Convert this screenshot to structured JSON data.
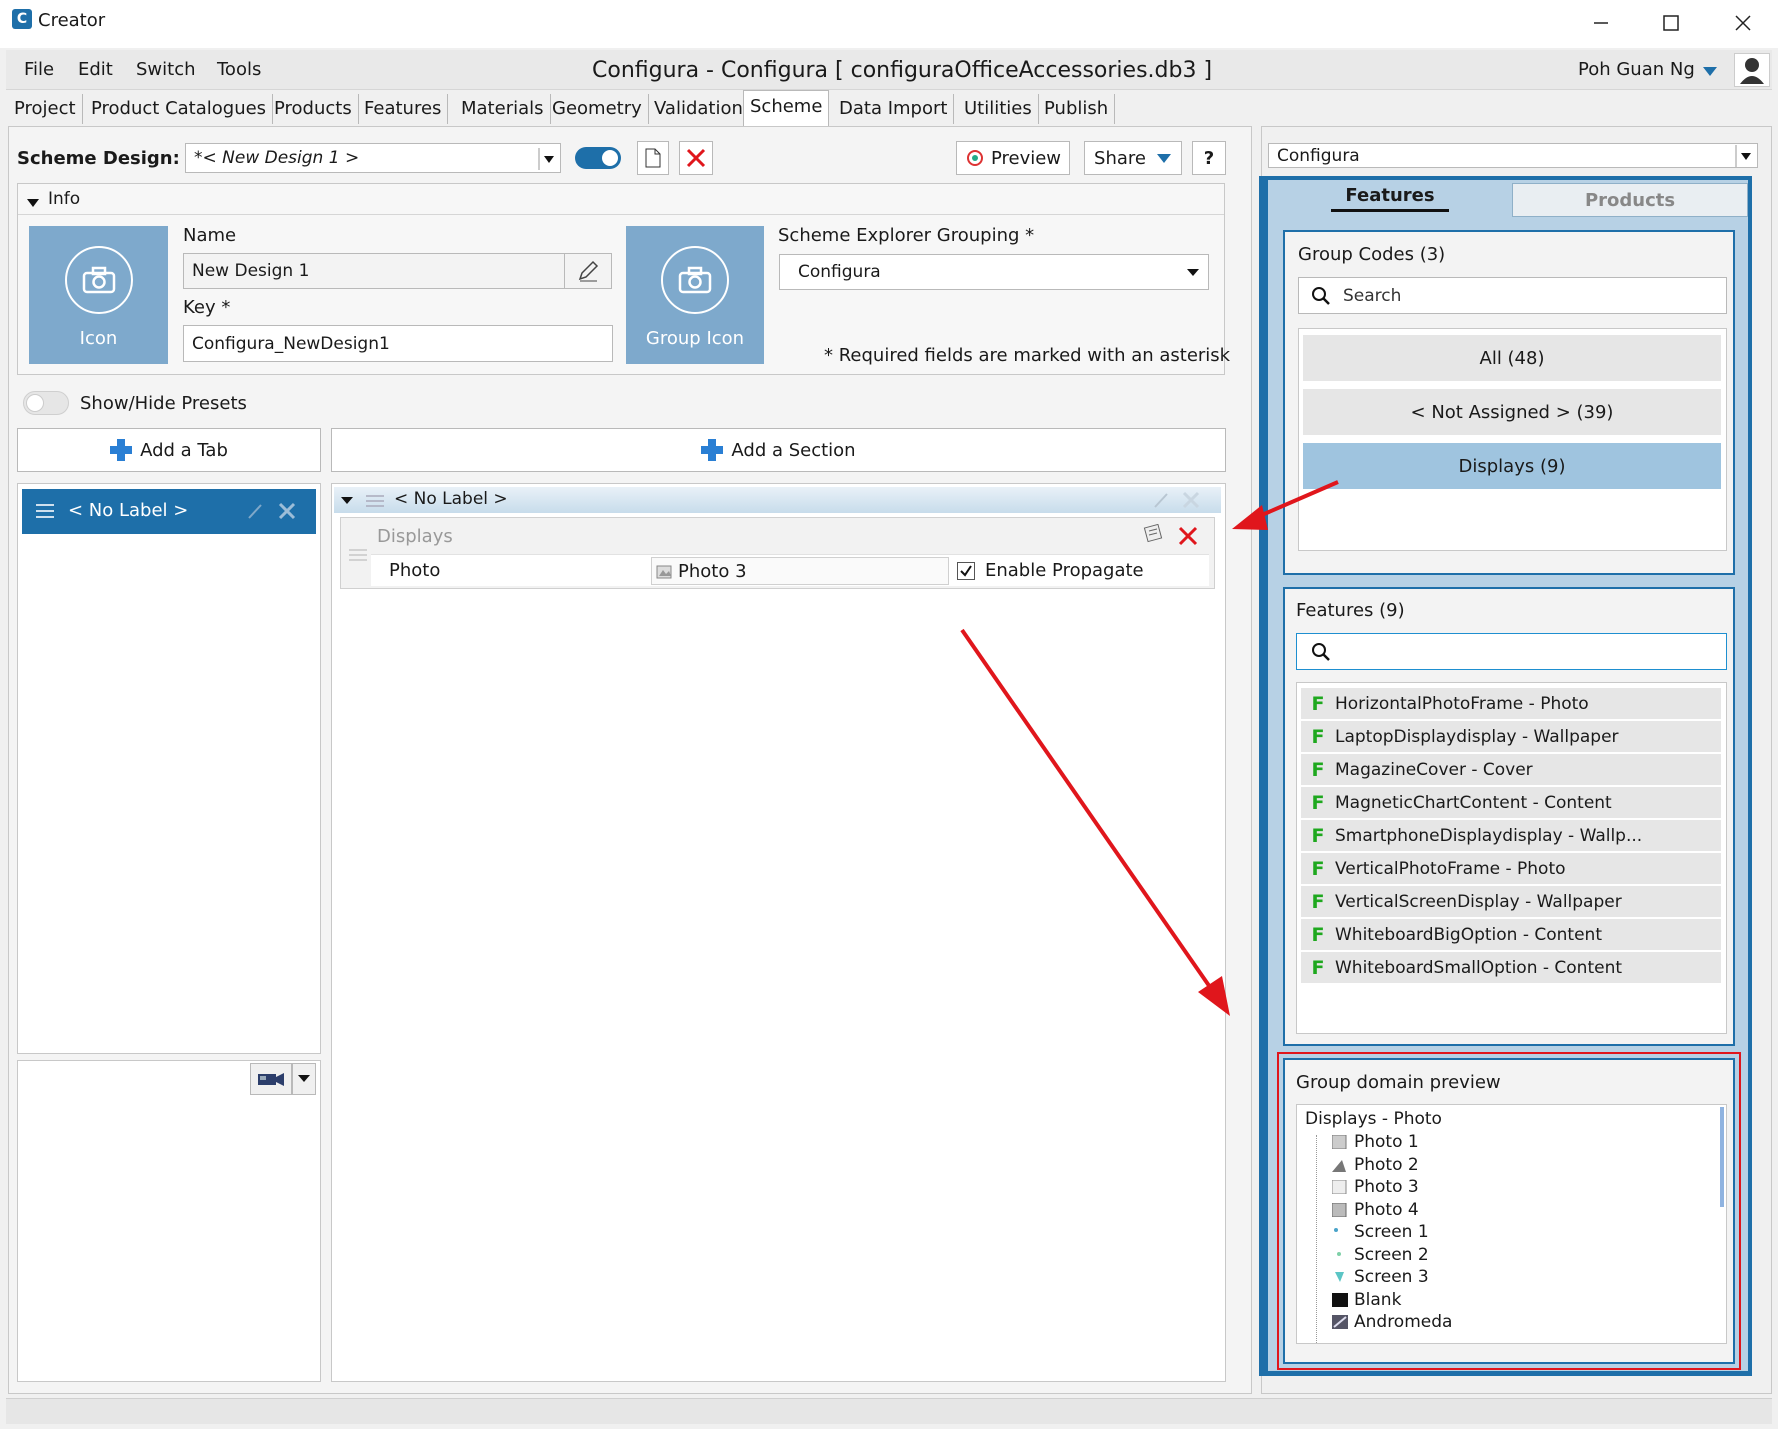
{
  "window": {
    "app_name": "Creator",
    "title": "Configura - Configura [ configuraOfficeAccessories.db3 ]"
  },
  "menu": {
    "file": "File",
    "edit": "Edit",
    "switch": "Switch",
    "tools": "Tools",
    "user": "Poh Guan Ng"
  },
  "tabs": [
    "Project",
    "Product Catalogues",
    "Products",
    "Features",
    "Materials",
    "Geometry",
    "Validation",
    "Scheme",
    "Data Import",
    "Utilities",
    "Publish"
  ],
  "scheme": {
    "label": "Scheme Design:",
    "design_value": "*< New Design 1 >",
    "preview": "Preview",
    "share": "Share",
    "help": "?"
  },
  "info": {
    "header": "Info",
    "icon_label": "Icon",
    "name_label": "Name",
    "name_value": "New Design 1",
    "key_label": "Key *",
    "key_value": "Configura_NewDesign1",
    "group_icon_label": "Group Icon",
    "grouping_label": "Scheme Explorer Grouping *",
    "grouping_value": "Configura",
    "required_note": "* Required fields are marked with an asterisk"
  },
  "presets": {
    "label": "Show/Hide Presets"
  },
  "add_tab": "Add a Tab",
  "add_section": "Add a Section",
  "tab_item": "< No Label >",
  "section": {
    "header": "< No Label >",
    "group_title": "Displays",
    "row_label": "Photo",
    "row_value": "Photo 3",
    "propagate_label": "Enable Propagate"
  },
  "right": {
    "source": "Configura",
    "tab_features": "Features",
    "tab_products": "Products",
    "group_codes_title": "Group Codes (3)",
    "search_placeholder": "Search",
    "group_codes": [
      "All (48)",
      "< Not Assigned > (39)",
      "Displays (9)"
    ],
    "features_title": "Features (9)",
    "features": [
      "HorizontalPhotoFrame - Photo",
      "LaptopDisplaydisplay - Wallpaper",
      "MagazineCover - Cover",
      "MagneticChartContent - Content",
      "SmartphoneDisplaydisplay - Wallp...",
      "VerticalPhotoFrame - Photo",
      "VerticalScreenDisplay - Wallpaper",
      "WhiteboardBigOption - Content",
      "WhiteboardSmallOption - Content"
    ],
    "preview_title": "Group domain preview",
    "tree_root": "Displays - Photo",
    "tree_items": [
      "Photo 1",
      "Photo 2",
      "Photo 3",
      "Photo 4",
      "Screen 1",
      "Screen 2",
      "Screen 3",
      "Blank",
      "Andromeda"
    ]
  },
  "colors": {
    "accent": "#1e6fa9",
    "selected": "#9fc4df",
    "panel_blue": "#1e6fa9",
    "annotation_red": "#e0161c"
  }
}
